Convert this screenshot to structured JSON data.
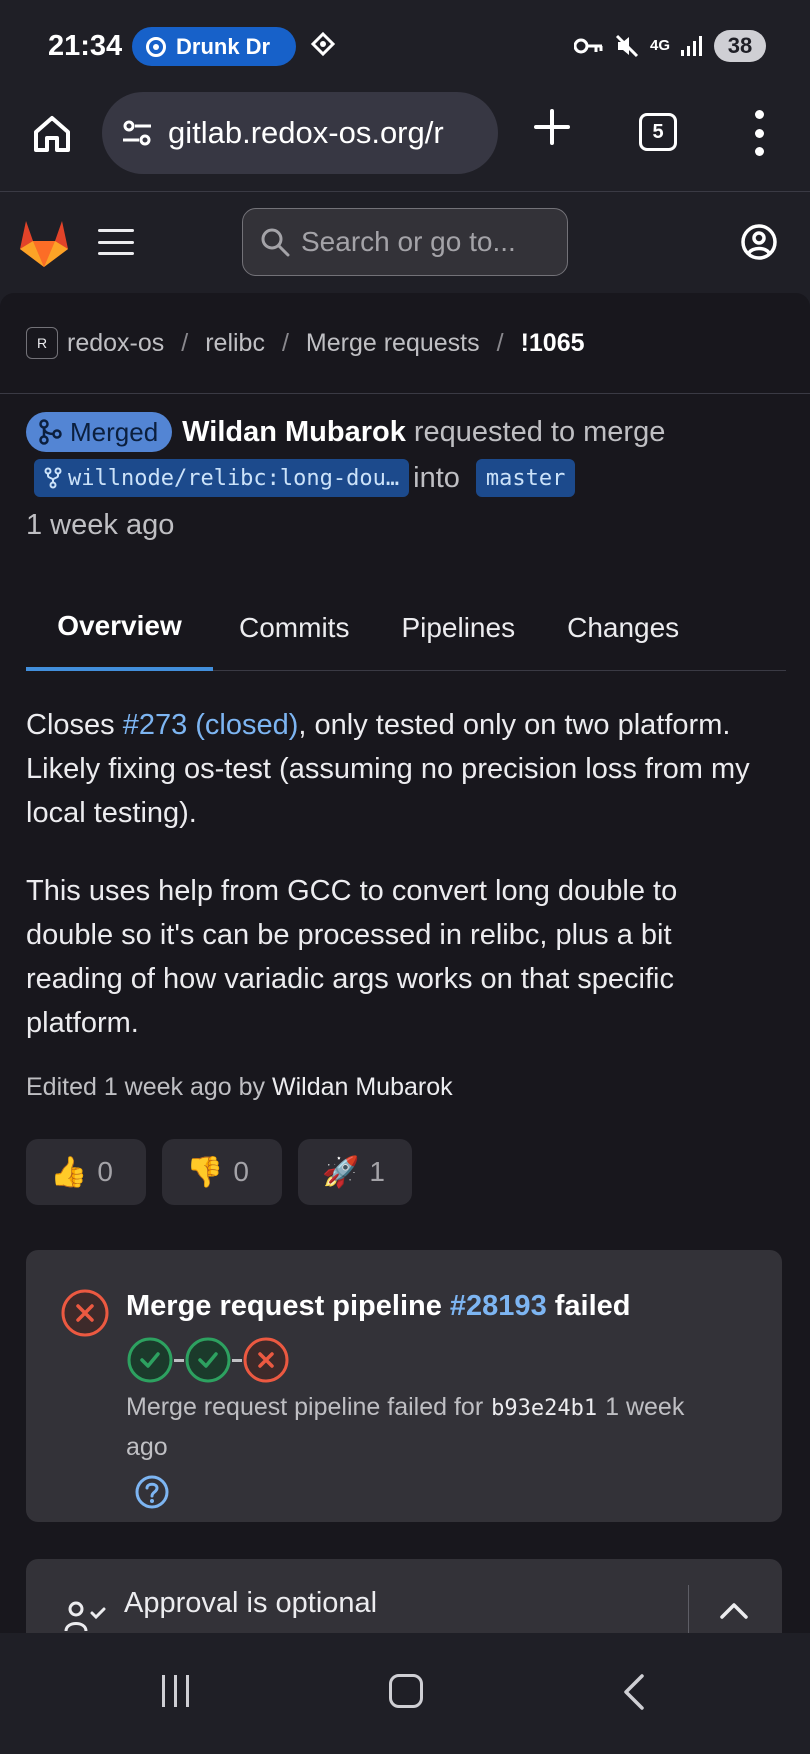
{
  "status_bar": {
    "time": "21:34",
    "notification_pill": "Drunk Dr",
    "battery": "38",
    "network_label": "4G"
  },
  "browser": {
    "url": "gitlab.redox-os.org/r",
    "tab_count": "5"
  },
  "gitlab_header": {
    "search_placeholder": "Search or go to..."
  },
  "breadcrumb": {
    "items": [
      "redox-os",
      "relibc",
      "Merge requests",
      "!1065"
    ],
    "separator": "/"
  },
  "merge_request": {
    "status_badge": "Merged",
    "author": "Wildan Mubarok",
    "action": "requested to merge",
    "source_branch": "willnode/relibc:long-dou…",
    "into_label": "into",
    "target_branch": "master",
    "time": "1 week ago"
  },
  "tabs": [
    "Overview",
    "Commits",
    "Pipelines",
    "Changes"
  ],
  "description": {
    "p1_before": "Closes ",
    "p1_link": "#273 (closed)",
    "p1_after": ", only tested only on two platform. Likely fixing os-test (assuming no precision loss from my local testing).",
    "p2": "This uses help from GCC to convert long double to double so it's can be processed in relibc, plus a bit reading of how variadic args works on that specific platform."
  },
  "edited": {
    "prefix": "Edited 1 week ago by ",
    "by": "Wildan Mubarok"
  },
  "reactions": [
    {
      "emoji": "👍",
      "count": "0"
    },
    {
      "emoji": "👎",
      "count": "0"
    },
    {
      "emoji": "🚀",
      "count": "1"
    }
  ],
  "pipeline": {
    "title_prefix": "Merge request pipeline ",
    "pipeline_id": "#28193",
    "title_suffix": " failed",
    "subtitle_prefix": "Merge request pipeline failed for",
    "sha": "b93e24b1",
    "subtitle_suffix": "1 week ago",
    "stages": [
      "passed",
      "passed",
      "failed"
    ],
    "colors": {
      "failed": "#ec5941",
      "passed": "#2da160"
    }
  },
  "approval": {
    "text": "Approval is optional"
  }
}
